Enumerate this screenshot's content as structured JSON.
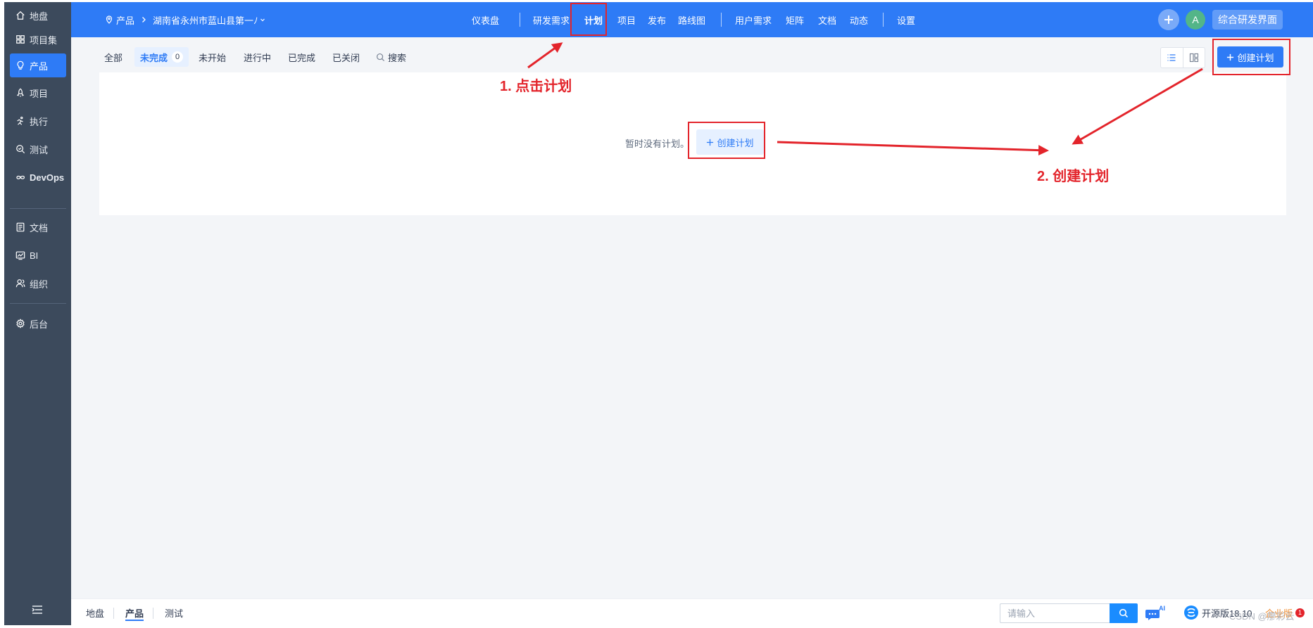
{
  "colors": {
    "primary": "#2e7bf6",
    "sidebar_bg": "#3c4a5c",
    "annotation": "#e3242b",
    "enterprise": "#f08c2f"
  },
  "sidebar": {
    "items": [
      {
        "label": "地盘",
        "icon": "home-icon"
      },
      {
        "label": "项目集",
        "icon": "grid-icon"
      },
      {
        "label": "产品",
        "icon": "lightbulb-icon",
        "active": true
      },
      {
        "label": "项目",
        "icon": "rocket-icon"
      },
      {
        "label": "执行",
        "icon": "run-icon"
      },
      {
        "label": "测试",
        "icon": "search-check-icon"
      },
      {
        "label": "DevOps",
        "icon": "infinity-icon"
      },
      {
        "label": "文档",
        "icon": "document-icon"
      },
      {
        "label": "BI",
        "icon": "chart-icon"
      },
      {
        "label": "组织",
        "icon": "user-icon"
      },
      {
        "label": "后台",
        "icon": "gear-icon"
      }
    ],
    "toggle_icon": "menu-collapse-icon"
  },
  "header": {
    "crumb_product": "产品",
    "crumb_name": "湖南省永州市蓝山县第一ﾉ",
    "nav": {
      "dashboard": "仪表盘",
      "requirements": "研发需求",
      "plan": "计划",
      "project": "项目",
      "release": "发布",
      "roadmap": "路线图",
      "user_req": "用户需求",
      "matrix": "矩阵",
      "docs": "文档",
      "dynamic": "动态",
      "settings": "设置"
    },
    "avatar_letter": "A",
    "space_label": "综合研发界面"
  },
  "toolbar": {
    "tabs": {
      "all": "全部",
      "unfinished": "未完成",
      "unfinished_count": "0",
      "not_started": "未开始",
      "in_progress": "进行中",
      "done": "已完成",
      "closed": "已关闭",
      "search": "搜索"
    },
    "create_label": "创建计划"
  },
  "main": {
    "empty_text": "暂时没有计划。",
    "empty_create_label": "创建计划"
  },
  "annotations": {
    "step1": "1. 点击计划",
    "step2": "2. 创建计划"
  },
  "footer": {
    "items": {
      "home": "地盘",
      "product": "产品",
      "test": "测试"
    },
    "search_placeholder": "请输入",
    "ai_label": "AI",
    "version": "开源版18.10",
    "enterprise": "企业版",
    "badge": "1"
  },
  "watermark": "CSDN @廖彩云"
}
